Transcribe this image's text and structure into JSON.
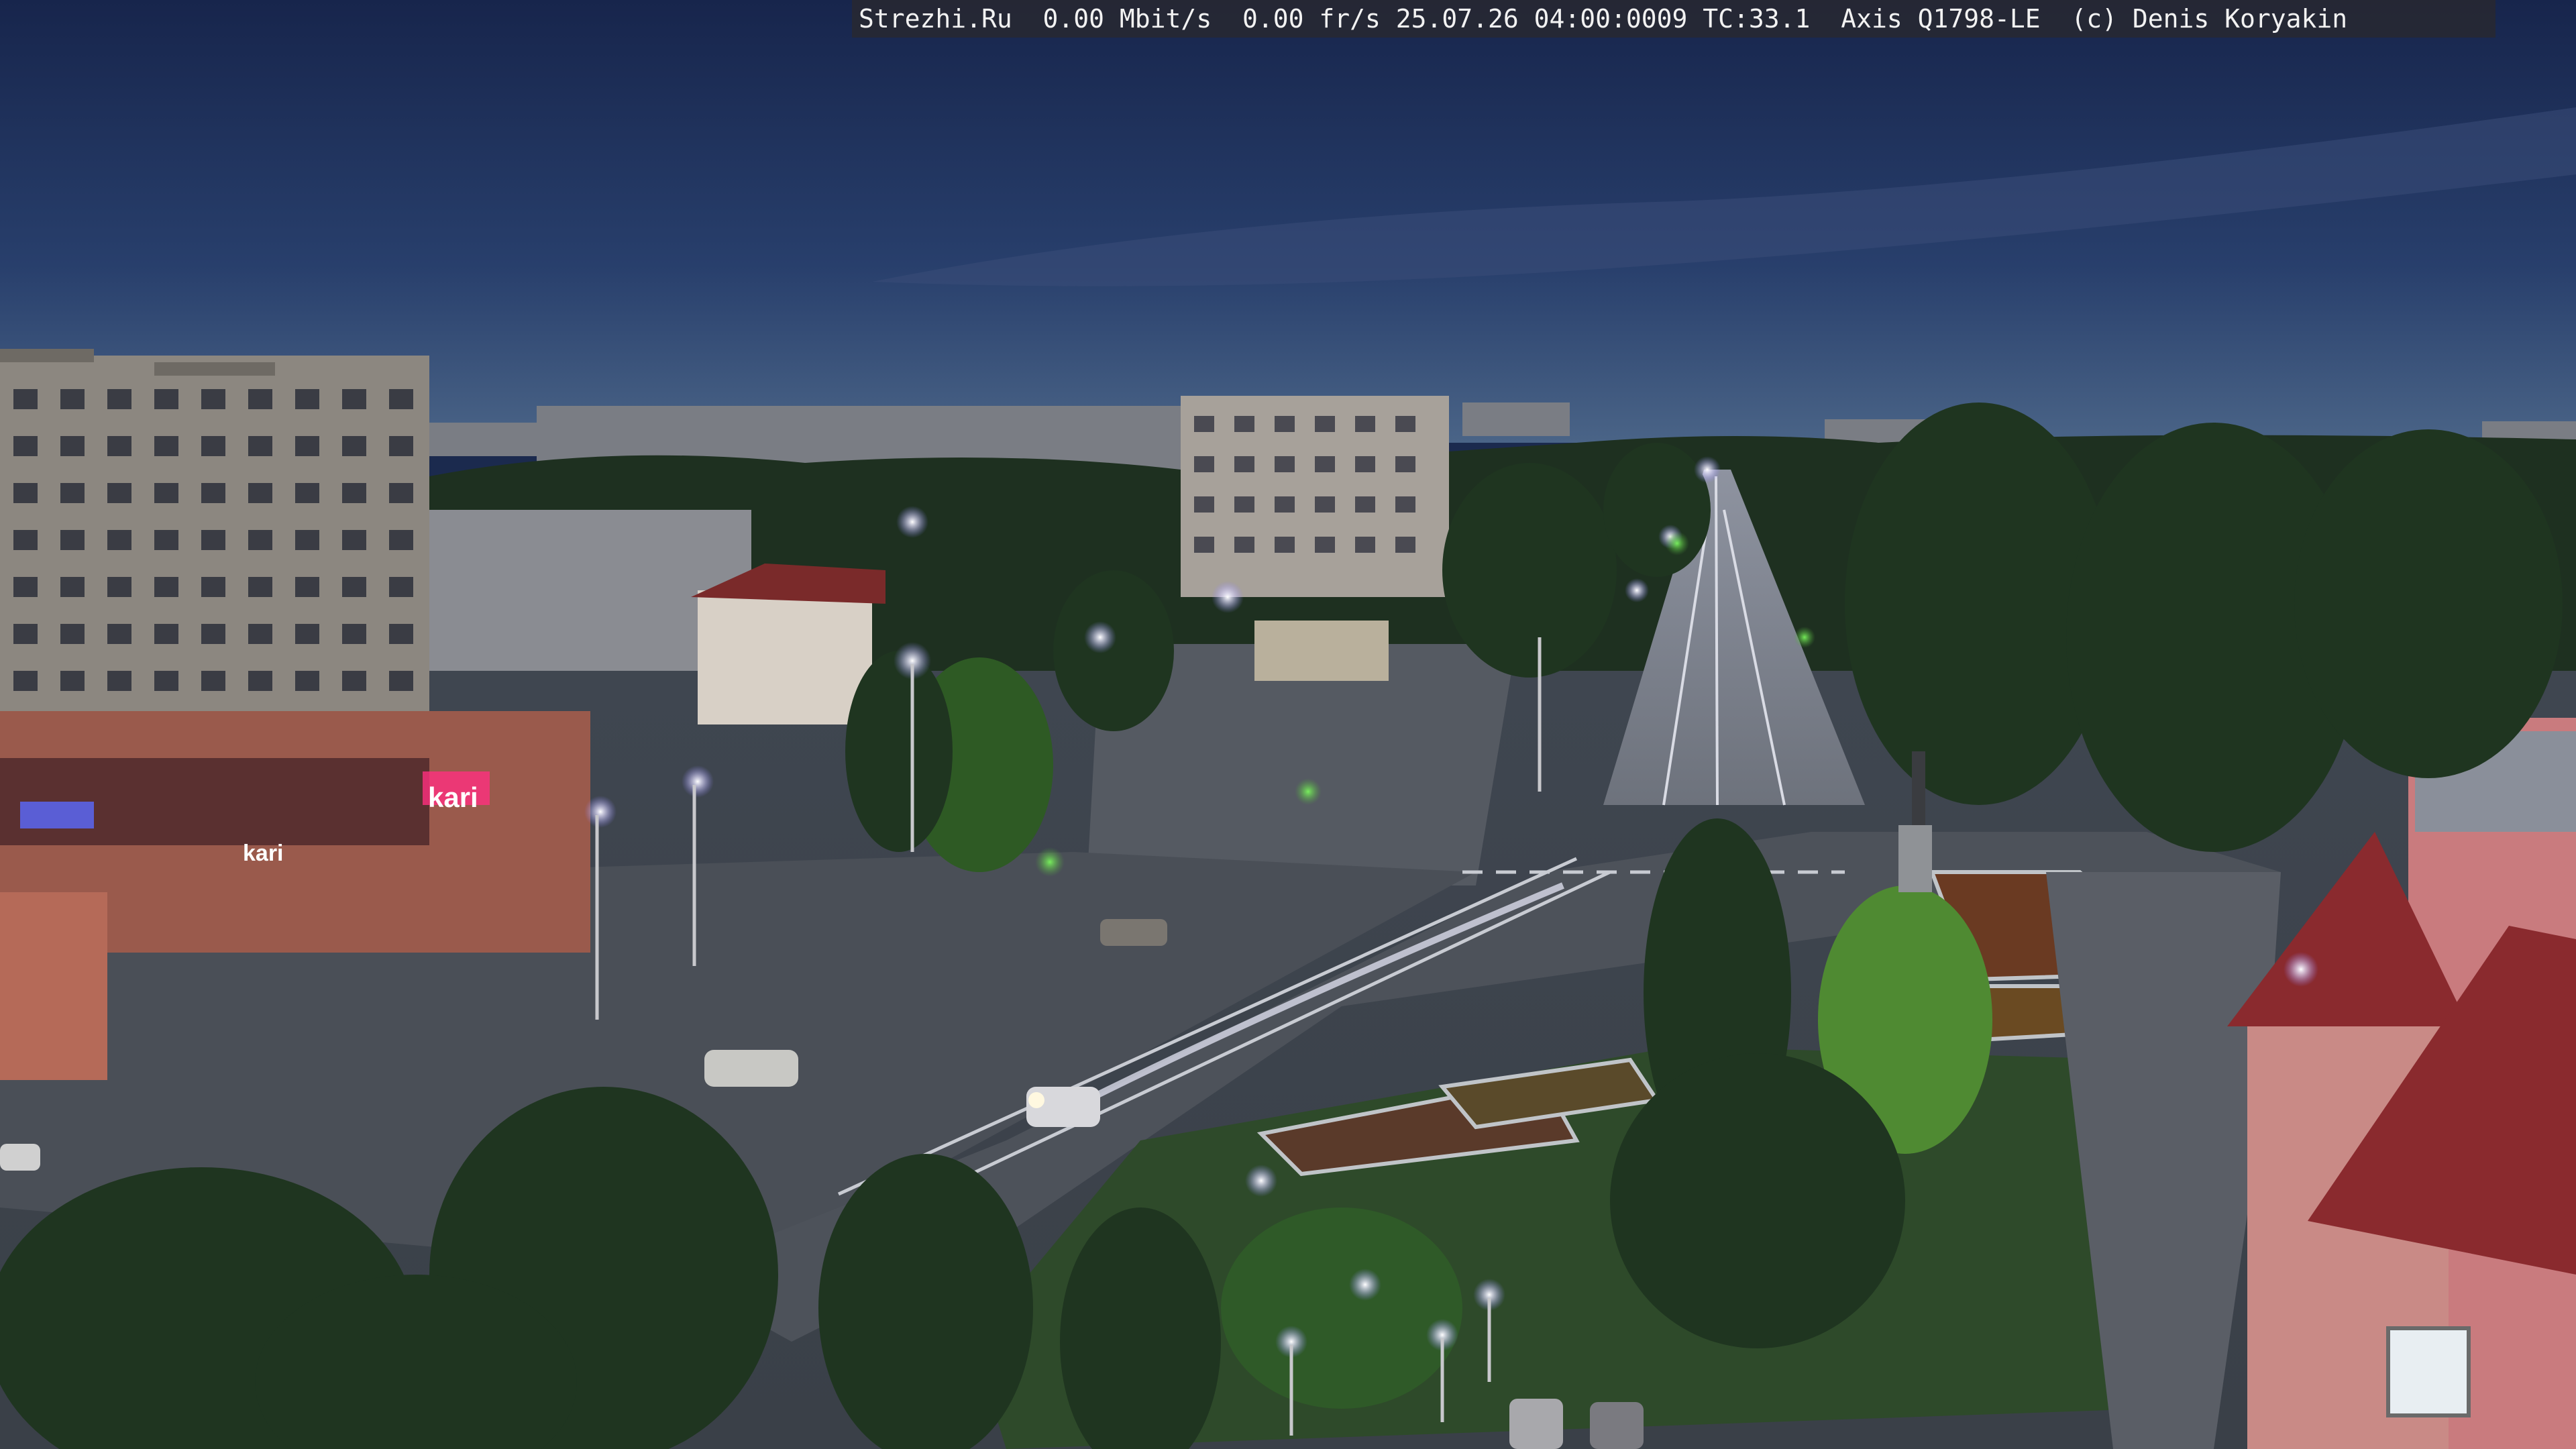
{
  "camera": {
    "site": "Strezhi.Ru",
    "bitrate": "0.00 Mbit/s",
    "framerate": "0.00 fr/s",
    "timestamp": "25.07.26 04:00:0009",
    "temperature": "TC:33.1",
    "model": "Axis Q1798-LE",
    "copyright": "(c) Denis Koryakin",
    "overlay_text": "Strezhi.Ru  0.00 Mbit/s  0.00 fr/s 25.07.26 04:00:0009 TC:33.1  Axis Q1798-LE  (c) Denis Koryakin"
  },
  "signage": {
    "store_sign": "kari",
    "store_sign_lower": "kari"
  },
  "colors": {
    "sky_top": "#1a2a55",
    "sky_horizon": "#3d557c",
    "tree_dark": "#1f3320",
    "road": "#4a4e55",
    "street_light": "#f4f0ff",
    "pink_building": "#c97b7e",
    "roof_red": "#8a2a2e"
  }
}
